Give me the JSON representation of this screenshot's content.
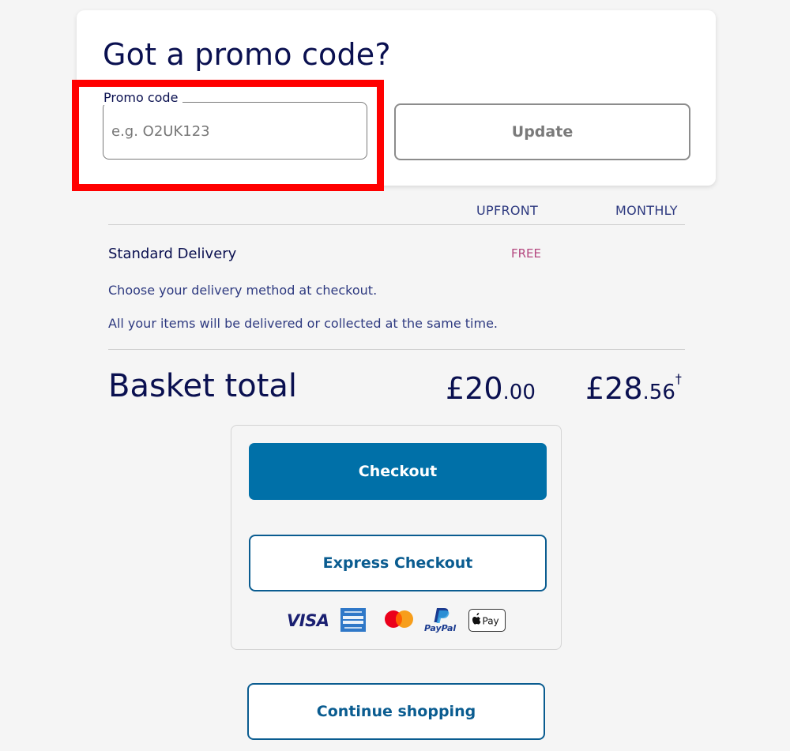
{
  "promo": {
    "title": "Got a promo code?",
    "field_label": "Promo code",
    "placeholder": "e.g. O2UK123",
    "value": "",
    "update_label": "Update"
  },
  "summary": {
    "col_upfront": "UPFRONT",
    "col_monthly": "MONTHLY",
    "delivery_label": "Standard Delivery",
    "delivery_upfront": "FREE",
    "info_line_1": "Choose your delivery method at checkout.",
    "info_line_2": "All your items will be delivered or collected at the same time.",
    "basket_total_label": "Basket total",
    "upfront_major": "£20",
    "upfront_minor": ".00",
    "monthly_major": "£28",
    "monthly_minor": ".56",
    "monthly_dagger": "†"
  },
  "checkout": {
    "checkout_label": "Checkout",
    "express_label": "Express Checkout",
    "payment_methods": [
      "VISA",
      "American Express",
      "Mastercard",
      "PayPal",
      "Apple Pay"
    ],
    "visa_text": "VISA",
    "paypal_text": "PayPal",
    "applepay_text": "Pay"
  },
  "continue_label": "Continue shopping",
  "colors": {
    "primary_blue": "#0070a8",
    "navy_text": "#0a1050",
    "free_pink": "#b4477f",
    "highlight_red": "#ff0000"
  }
}
